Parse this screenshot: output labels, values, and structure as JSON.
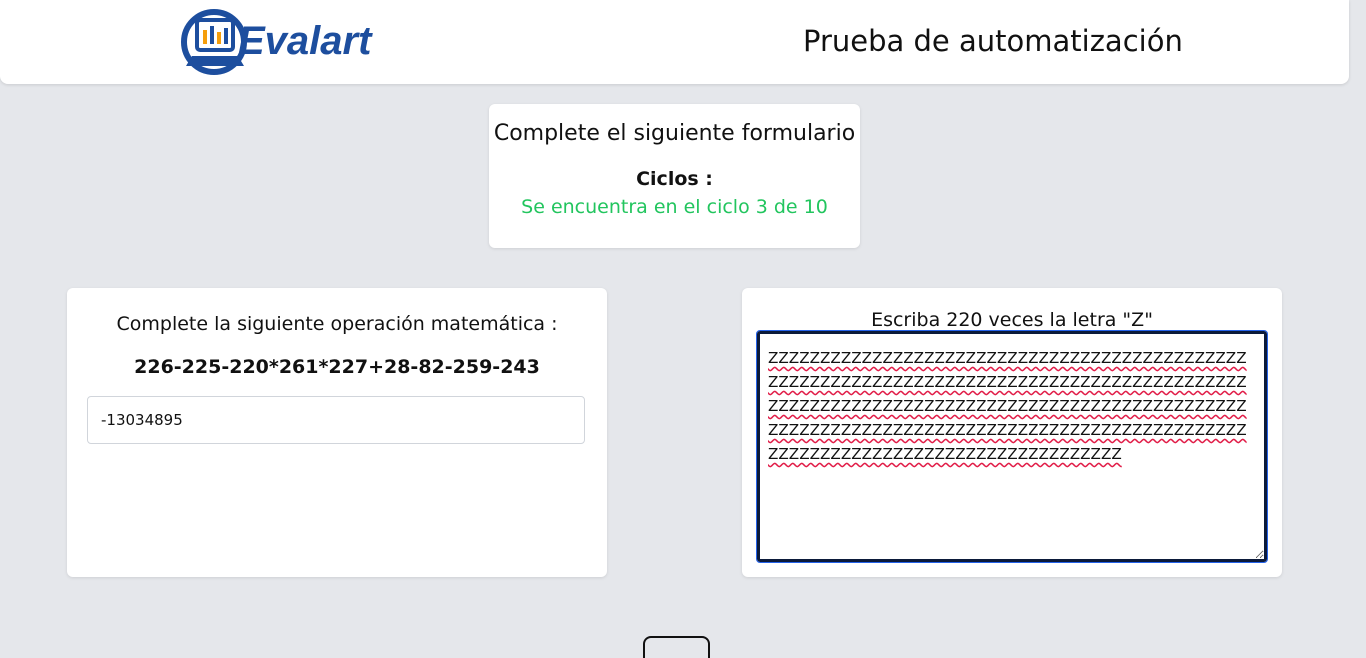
{
  "header": {
    "logo_text": "Evalart",
    "title": "Prueba de automatización"
  },
  "status": {
    "title": "Complete el siguiente formulario",
    "cycles_label": "Ciclos :",
    "cycles_value": "Se encuentra en el ciclo 3 de 10"
  },
  "math": {
    "label": "Complete la siguiente operación matemática :",
    "expression": "226-225-220*261*227+28-82-259-243",
    "answer_value": "-13034895"
  },
  "text_task": {
    "label": "Escriba 220 veces la letra \"Z\"",
    "value": "ZZZZZZZZZZZZZZZZZZZZZZZZZZZZZZZZZZZZZZZZZZZZZZZZZZZZZZZZZZZZZZZZZZZZZZZZZZZZZZZZZZZZZZZZZZZZZZZZZZZZZZZZZZZZZZZZZZZZZZZZZZZZZZZZZZZZZZZZZZZZZZZZZZZZZZZZZZZZZZZZZZZZZZZZZZZZZZZZZZZZZZZZZZZZZZZZZZZZZZZZZZZZZZZZZZZZZZZZZZ"
  },
  "colors": {
    "accent_green": "#22c55e",
    "brand_blue": "#1d4e9e",
    "focus_blue": "#2563eb"
  }
}
